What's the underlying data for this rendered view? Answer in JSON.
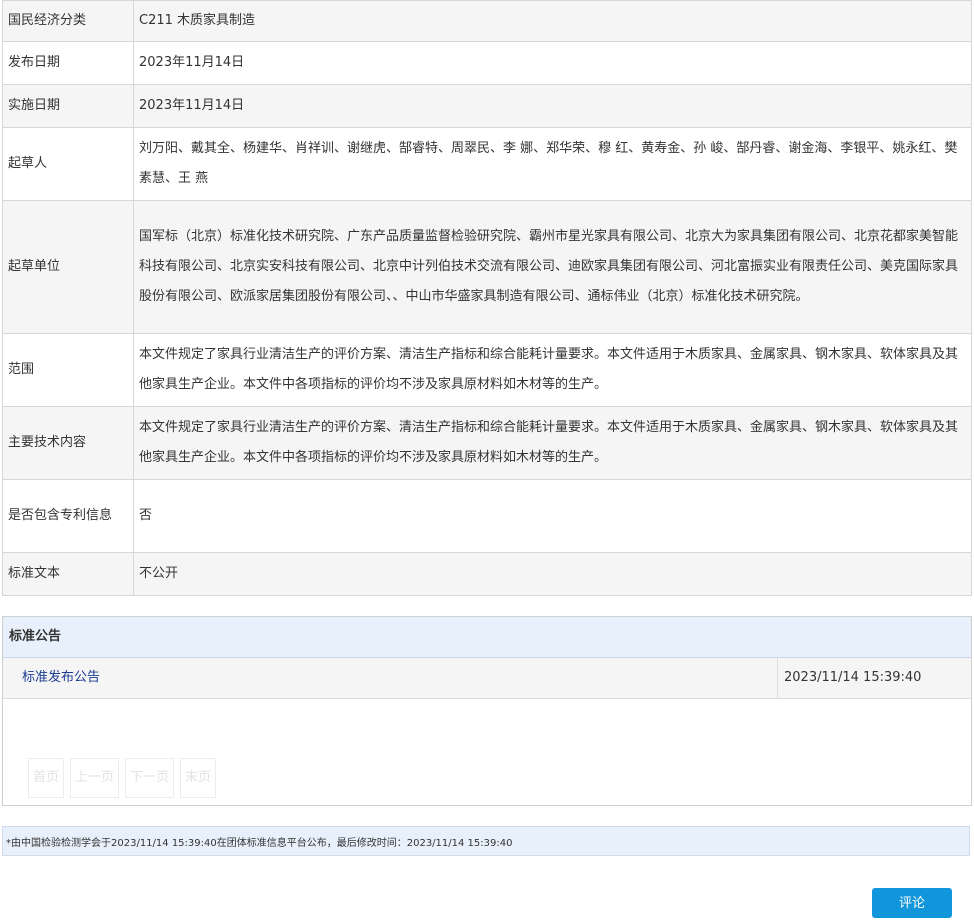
{
  "info_rows": [
    {
      "label": "国民经济分类",
      "value": "C211 木质家具制造"
    },
    {
      "label": "发布日期",
      "value": "2023年11月14日"
    },
    {
      "label": "实施日期",
      "value": "2023年11月14日"
    },
    {
      "label": "起草人",
      "value": "刘万阳、戴其全、杨建华、肖祥训、谢继虎、郜睿特、周翠民、李 娜、郑华荣、穆 红、黄寿金、孙 峻、郜丹睿、谢金海、李银平、姚永红、樊素慧、王 燕"
    },
    {
      "label": "起草单位",
      "value": "国军标（北京）标准化技术研究院、广东产品质量监督检验研究院、霸州市星光家具有限公司、北京大为家具集团有限公司、北京花都家美智能科技有限公司、北京实安科技有限公司、北京中计列伯技术交流有限公司、迪欧家具集团有限公司、河北富振实业有限责任公司、美克国际家具股份有限公司、欧派家居集团股份有限公司、、中山市华盛家具制造有限公司、通标伟业（北京）标准化技术研究院。"
    },
    {
      "label": "范围",
      "value": "本文件规定了家具行业清洁生产的评价方案、清洁生产指标和综合能耗计量要求。本文件适用于木质家具、金属家具、钢木家具、软体家具及其他家具生产企业。本文件中各项指标的评价均不涉及家具原材料如木材等的生产。"
    },
    {
      "label": "主要技术内容",
      "value": "本文件规定了家具行业清洁生产的评价方案、清洁生产指标和综合能耗计量要求。本文件适用于木质家具、金属家具、钢木家具、软体家具及其他家具生产企业。本文件中各项指标的评价均不涉及家具原材料如木材等的生产。"
    },
    {
      "label": "是否包含专利信息",
      "value": "否"
    },
    {
      "label": "标准文本",
      "value": "不公开"
    }
  ],
  "notice": {
    "header": "标准公告",
    "items": [
      {
        "title": "标准发布公告",
        "date": "2023/11/14 15:39:40"
      }
    ]
  },
  "pager": {
    "first": "首页",
    "prev": "上一页",
    "next": "下一页",
    "last": "末页"
  },
  "footer_note": "*由中国检验检测学会于2023/11/14 15:39:40在团体标准信息平台公布，最后修改时间：2023/11/14 15:39:40",
  "comment_button": "评论"
}
